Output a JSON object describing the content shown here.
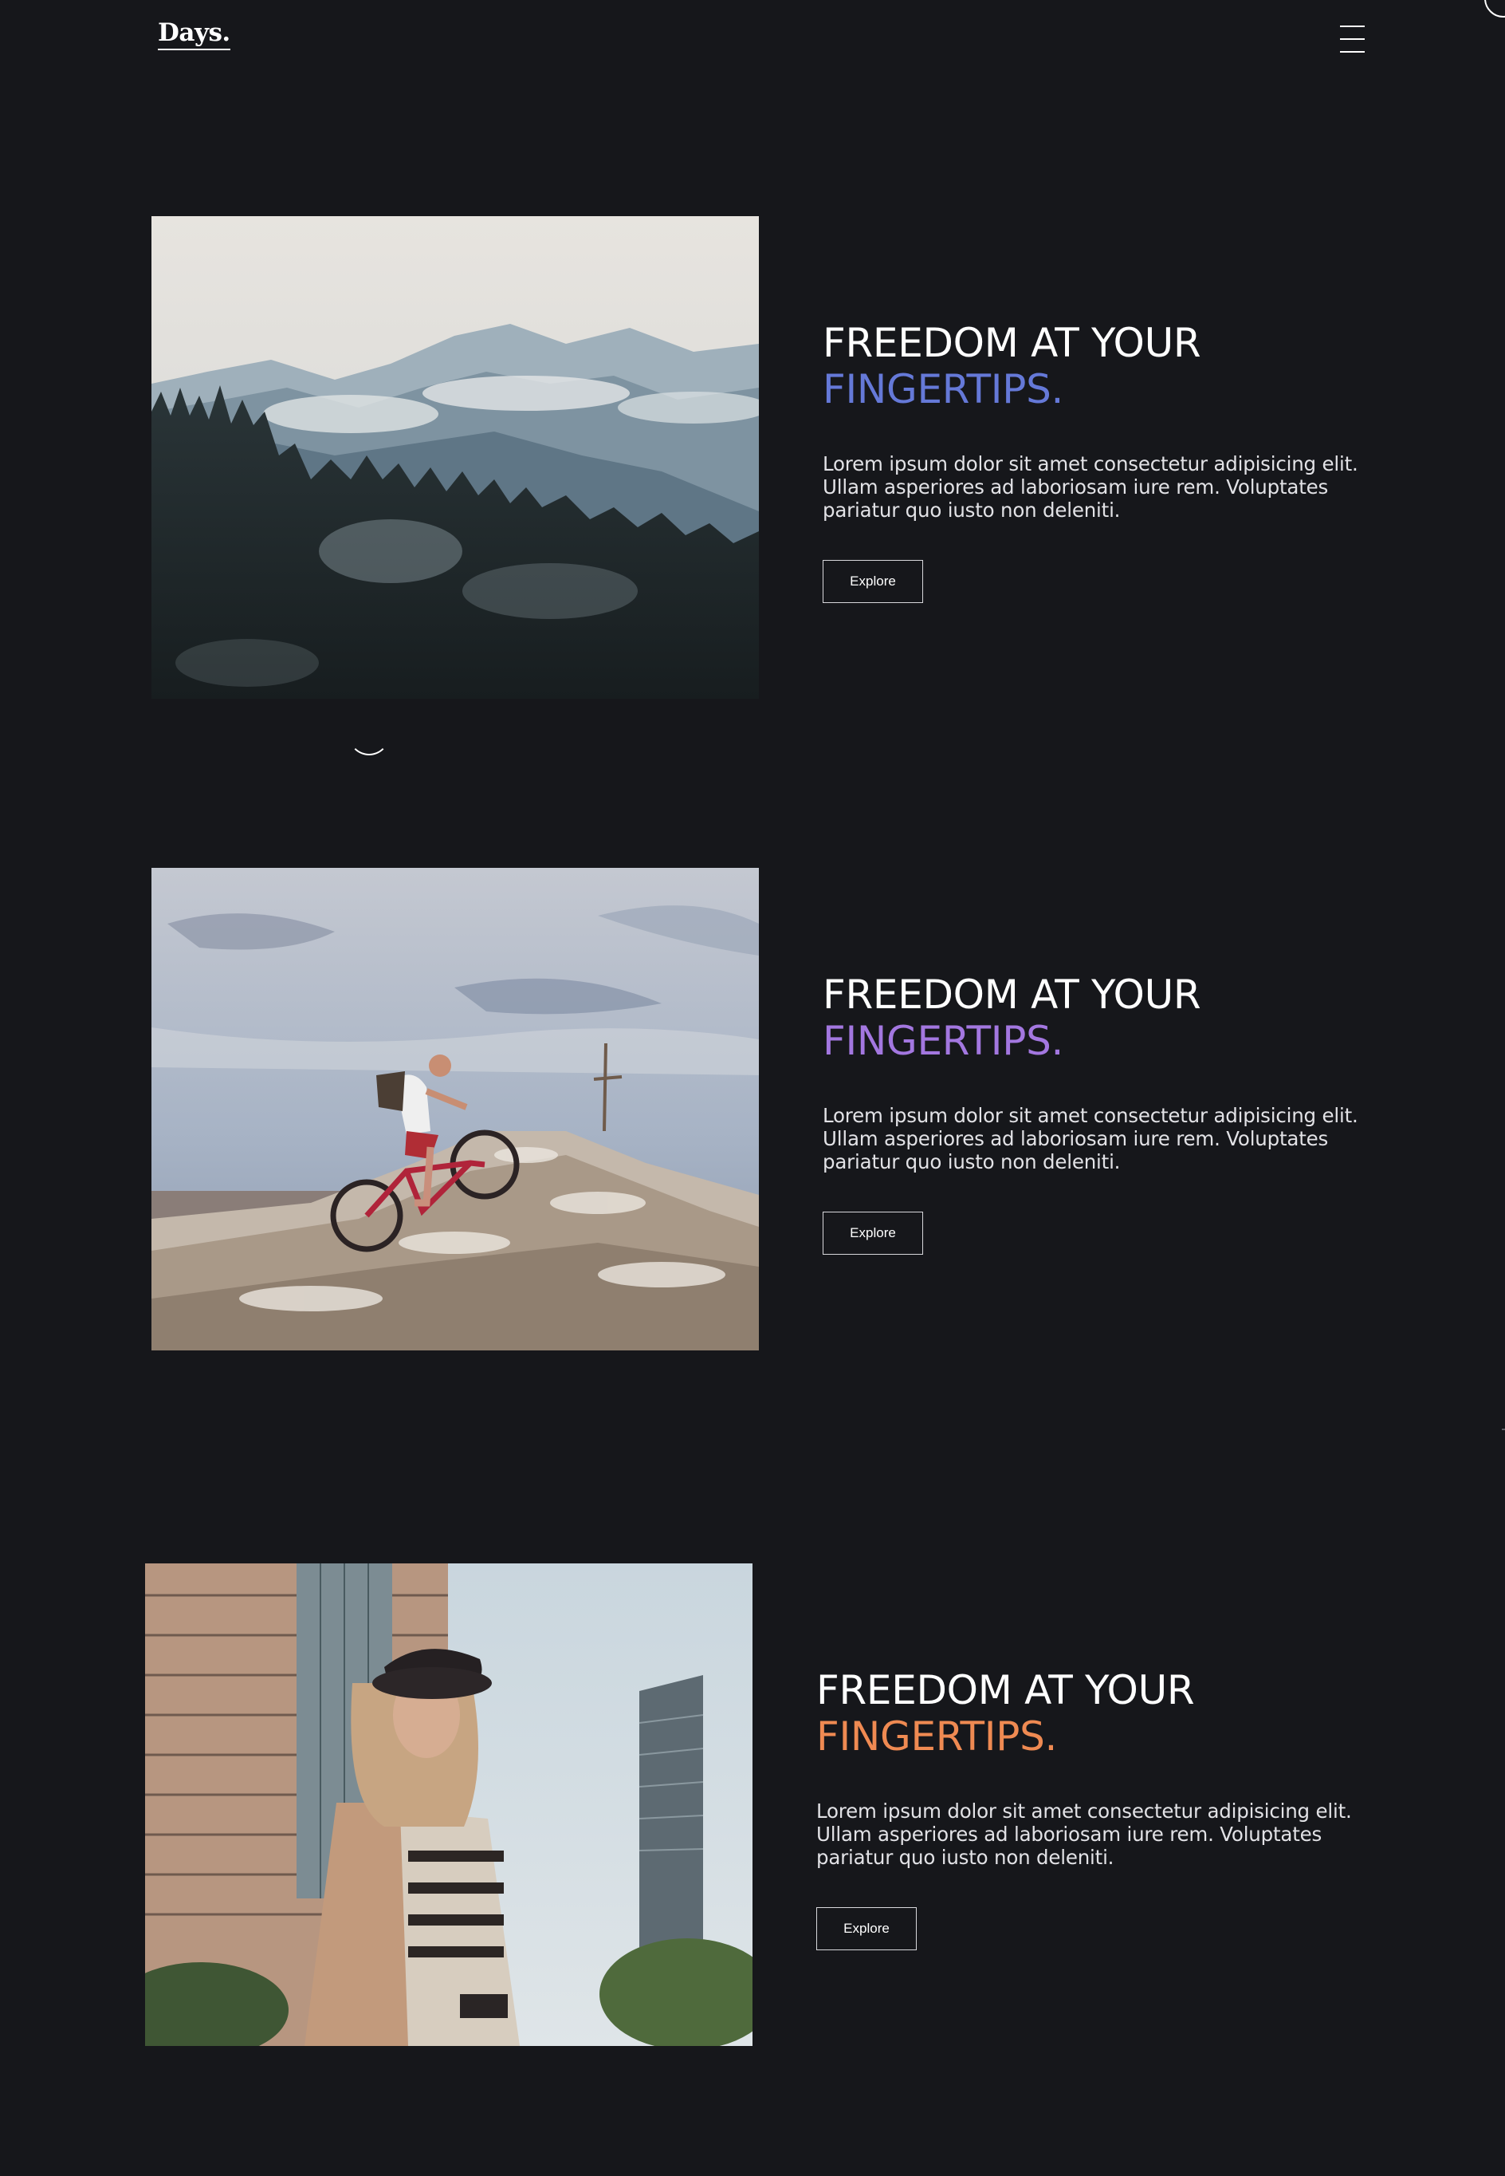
{
  "header": {
    "logo": "Days.",
    "menu_icon": "hamburger-menu-icon"
  },
  "features": [
    {
      "image": "misty-forest-mountains-photo",
      "headline_line1": "FREEDOM AT YOUR",
      "headline_line2": "FINGERTIPS.",
      "accent_color": "#6579d8",
      "body": "Lorem ipsum dolor sit amet consectetur adipisicing elit. Ullam asperiores ad laboriosam iure rem. Voluptates pariatur quo iusto non deleniti.",
      "button_label": "Explore"
    },
    {
      "image": "mountain-biker-on-rocky-summit-photo",
      "headline_line1": "FREEDOM AT YOUR",
      "headline_line2": "FINGERTIPS.",
      "accent_color": "#a377e0",
      "body": "Lorem ipsum dolor sit amet consectetur adipisicing elit. Ullam asperiores ad laboriosam iure rem. Voluptates pariatur quo iusto non deleniti.",
      "button_label": "Explore"
    },
    {
      "image": "woman-in-city-with-skyscrapers-photo",
      "headline_line1": "FREEDOM AT YOUR",
      "headline_line2": "FINGERTIPS.",
      "accent_color": "#ef8a52",
      "body": "Lorem ipsum dolor sit amet consectetur adipisicing elit. Ullam asperiores ad laboriosam iure rem. Voluptates pariatur quo iusto non deleniti.",
      "button_label": "Explore"
    }
  ]
}
